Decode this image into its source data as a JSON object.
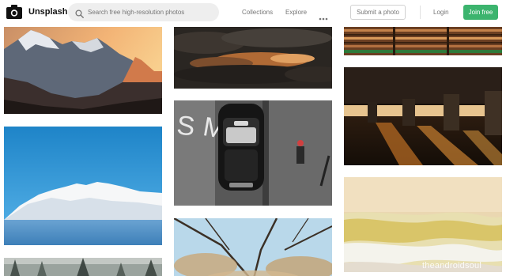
{
  "header": {
    "logo_icon": "camera-icon",
    "brand": "Unsplash",
    "search": {
      "placeholder": "Search free high-resolution photos",
      "icon": "search-icon"
    },
    "nav": {
      "collections": "Collections",
      "explore": "Explore",
      "more_icon": "ellipsis-icon"
    },
    "submit_label": "Submit a photo",
    "login_label": "Login",
    "join_label": "Join free",
    "join_color": "#3cb46e"
  },
  "photos": [
    {
      "column": 1,
      "subject": "mountain-sunset"
    },
    {
      "column": 1,
      "subject": "snowy-peak-blue-sky"
    },
    {
      "column": 1,
      "subject": "misty-forest"
    },
    {
      "column": 2,
      "subject": "stormy-clouds"
    },
    {
      "column": 2,
      "subject": "black-taxi-street"
    },
    {
      "column": 2,
      "subject": "bare-tree-branches"
    },
    {
      "column": 3,
      "subject": "striped-wooden-facade"
    },
    {
      "column": 3,
      "subject": "parking-garage-sunlight"
    },
    {
      "column": 3,
      "subject": "sand-and-waves"
    }
  ],
  "watermark": "theandroidsoul"
}
